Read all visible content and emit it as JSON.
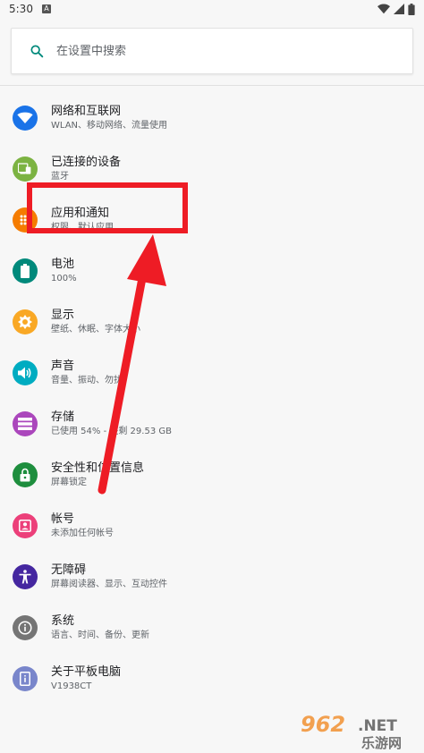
{
  "status": {
    "time": "5:30",
    "notif_letter": "A"
  },
  "search": {
    "placeholder": "在设置中搜索"
  },
  "settings": [
    {
      "title": "网络和互联网",
      "subtitle": "WLAN、移动网络、流量使用",
      "color": "#1a73e8",
      "icon": "wifi-icon"
    },
    {
      "title": "已连接的设备",
      "subtitle": "蓝牙",
      "color": "#7cb342",
      "icon": "devices-icon"
    },
    {
      "title": "应用和通知",
      "subtitle": "权限、默认应用",
      "color": "#f57c00",
      "icon": "apps-icon"
    },
    {
      "title": "电池",
      "subtitle": "100%",
      "color": "#00897b",
      "icon": "battery-icon"
    },
    {
      "title": "显示",
      "subtitle": "壁纸、休眠、字体大小",
      "color": "#f9a825",
      "icon": "display-icon"
    },
    {
      "title": "声音",
      "subtitle": "音量、振动、勿扰",
      "color": "#00acc1",
      "icon": "volume-icon"
    },
    {
      "title": "存储",
      "subtitle": "已使用 54% - 还剩 29.53 GB",
      "color": "#ab47bc",
      "icon": "storage-icon"
    },
    {
      "title": "安全性和位置信息",
      "subtitle": "屏幕锁定",
      "color": "#1e8e3e",
      "icon": "lock-icon"
    },
    {
      "title": "帐号",
      "subtitle": "未添加任何帐号",
      "color": "#ec407a",
      "icon": "account-icon"
    },
    {
      "title": "无障碍",
      "subtitle": "屏幕阅读器、显示、互动控件",
      "color": "#4527a0",
      "icon": "accessibility-icon"
    },
    {
      "title": "系统",
      "subtitle": "语言、时间、备份、更新",
      "color": "#757575",
      "icon": "info-icon"
    },
    {
      "title": "关于平板电脑",
      "subtitle": "V1938CT",
      "color": "#7986cb",
      "icon": "tablet-icon"
    }
  ],
  "annotation": {
    "color": "#ee1c25"
  },
  "watermark": {
    "number": "962",
    "suffix": ".NET",
    "cn": "乐游网"
  }
}
